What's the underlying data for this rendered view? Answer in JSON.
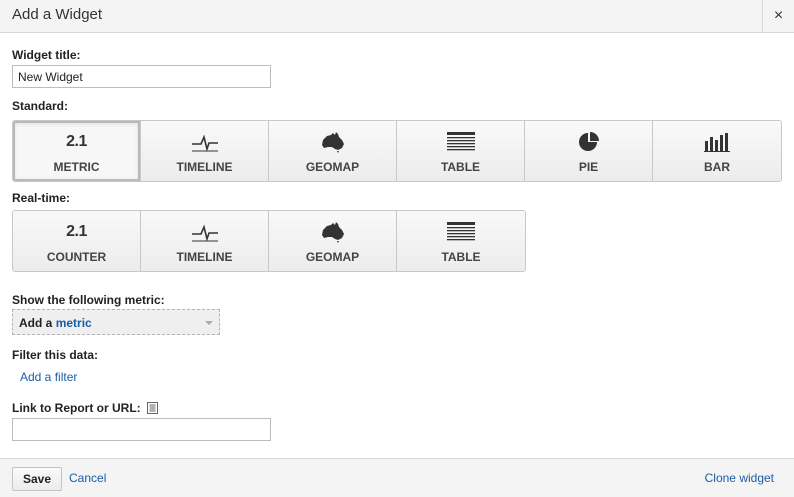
{
  "dialog": {
    "title": "Add a Widget",
    "close_glyph": "×"
  },
  "widget_title": {
    "label": "Widget title:",
    "value": "New Widget"
  },
  "standard": {
    "label": "Standard:",
    "options": [
      {
        "caption": "METRIC",
        "icon_text": "2.1",
        "icon": "metric-icon",
        "selected": true
      },
      {
        "caption": "TIMELINE",
        "icon": "timeline-icon"
      },
      {
        "caption": "GEOMAP",
        "icon": "australia-map-icon"
      },
      {
        "caption": "TABLE",
        "icon": "table-icon"
      },
      {
        "caption": "PIE",
        "icon": "pie-chart-icon"
      },
      {
        "caption": "BAR",
        "icon": "bar-chart-icon"
      }
    ]
  },
  "realtime": {
    "label": "Real-time:",
    "options": [
      {
        "caption": "COUNTER",
        "icon_text": "2.1",
        "icon": "counter-icon"
      },
      {
        "caption": "TIMELINE",
        "icon": "timeline-icon"
      },
      {
        "caption": "GEOMAP",
        "icon": "australia-map-icon"
      },
      {
        "caption": "TABLE",
        "icon": "table-icon"
      }
    ]
  },
  "metric": {
    "label": "Show the following metric:",
    "select_lead": "Add a",
    "select_link": "metric"
  },
  "filter": {
    "label": "Filter this data:",
    "add_link": "Add a filter"
  },
  "link_report": {
    "label": "Link to Report or URL:",
    "value": ""
  },
  "footer": {
    "save": "Save",
    "cancel": "Cancel",
    "clone": "Clone widget"
  },
  "colors": {
    "link": "#1a5ea8",
    "header_bg": "#f4f4f4"
  }
}
